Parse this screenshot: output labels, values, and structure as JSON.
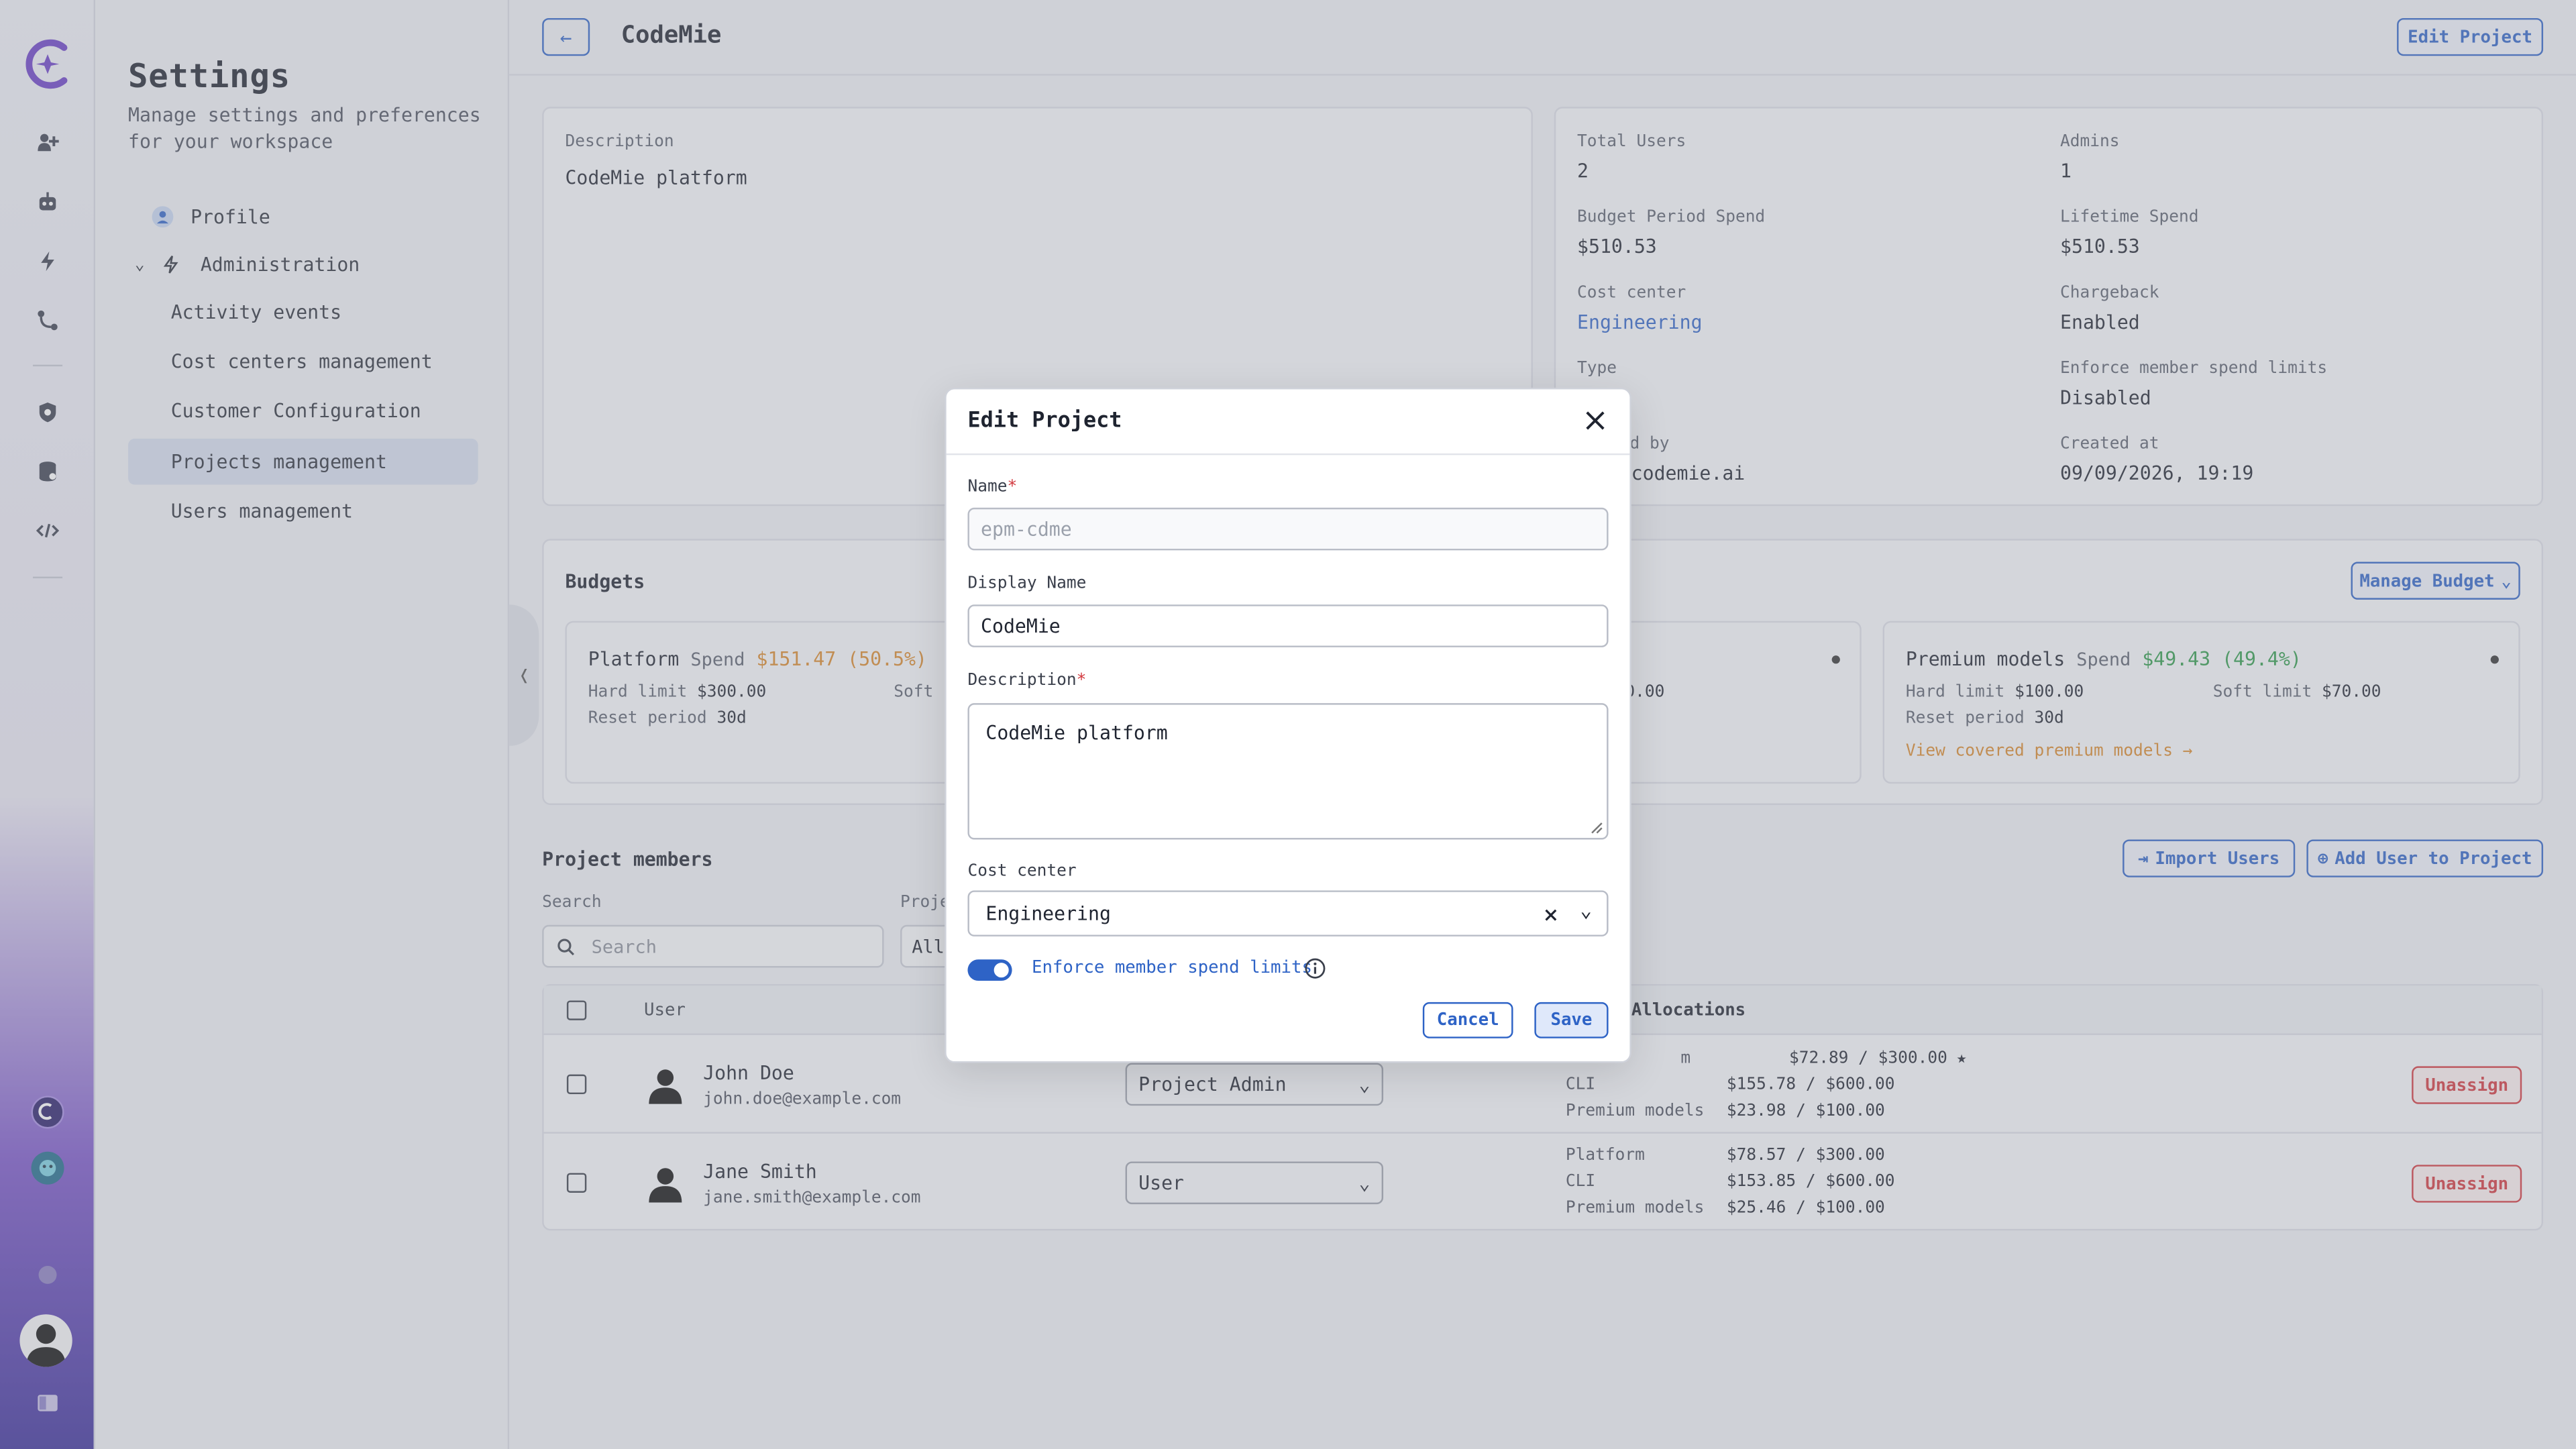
{
  "settings": {
    "title": "Settings",
    "subtitle": "Manage settings and preferences for your workspace",
    "profile": "Profile",
    "administration": "Administration",
    "items": [
      "Activity events",
      "Cost centers management",
      "Customer Configuration",
      "Projects management",
      "Users management"
    ]
  },
  "header": {
    "title": "CodeMie",
    "edit_button": "Edit Project"
  },
  "details": {
    "description_label": "Description",
    "description": "CodeMie platform",
    "total_users_label": "Total Users",
    "total_users": "2",
    "admins_label": "Admins",
    "admins": "1",
    "budget_spend_label": "Budget Period Spend",
    "budget_spend": "$510.53",
    "lifetime_label": "Lifetime Spend",
    "lifetime": "$510.53",
    "cost_center_label": "Cost center",
    "cost_center": "Engineering",
    "chargeback_label": "Chargeback",
    "chargeback": "Enabled",
    "type_label": "Type",
    "type_partial": "d",
    "enforce_label": "Enforce member spend limits",
    "enforce": "Disabled",
    "created_by_partial": "ed by",
    "created_by_value_partial": "@codemie.ai",
    "created_at_label": "Created at",
    "created_at": "09/09/2026, 19:19"
  },
  "budgets": {
    "title": "Budgets",
    "manage_button": "Manage Budget",
    "platform": {
      "name": "Platform",
      "spend_word": "Spend",
      "spend": "$151.47",
      "pct": "(50.5%)",
      "hard_label": "Hard limit",
      "hard": "$300.00",
      "soft_partial": "Soft",
      "reset_label": "Reset period",
      "reset": "30d"
    },
    "cli_partial": {
      "text": "t",
      "value": "$420.00"
    },
    "premium": {
      "name": "Premium models",
      "spend_word": "Spend",
      "spend": "$49.43",
      "pct": "(49.4%)",
      "hard_label": "Hard limit",
      "hard": "$100.00",
      "soft_label": "Soft limit",
      "soft": "$70.00",
      "reset_label": "Reset period",
      "reset": "30d",
      "link": "View covered premium models →"
    }
  },
  "members": {
    "title": "Project members",
    "import_button": "Import Users",
    "add_button": "Add User to Project",
    "search_label": "Search",
    "search_placeholder": "Search",
    "role_label_partial": "Proje",
    "role_filter_partial": "All",
    "col_user": "User",
    "col_alloc": "Allocations",
    "unassign": "Unassign",
    "rows": [
      {
        "name": "John Doe",
        "email": "john.doe@example.com",
        "role": "Project Admin",
        "alloc": [
          [
            "m",
            "$72.89 / $300.00"
          ],
          [
            "CLI",
            "$155.78 / $600.00"
          ],
          [
            "Premium models",
            "$23.98 / $100.00"
          ]
        ]
      },
      {
        "name": "Jane Smith",
        "email": "jane.smith@example.com",
        "role": "User",
        "alloc": [
          [
            "Platform",
            "$78.57 / $300.00"
          ],
          [
            "CLI",
            "$153.85 / $600.00"
          ],
          [
            "Premium models",
            "$25.46 / $100.00"
          ]
        ]
      }
    ]
  },
  "modal": {
    "title": "Edit Project",
    "name_label": "Name",
    "name_placeholder": "epm-cdme",
    "display_label": "Display Name",
    "display_value": "CodeMie",
    "desc_label": "Description",
    "desc_value": "CodeMie platform",
    "cost_label": "Cost center",
    "cost_value": "Engineering",
    "enforce_label": "Enforce member spend limits",
    "cancel": "Cancel",
    "save": "Save"
  },
  "colors": {
    "accent": "#2e63c6",
    "danger": "#d2383e",
    "orange": "#d9882a",
    "green": "#2f9a4a"
  }
}
